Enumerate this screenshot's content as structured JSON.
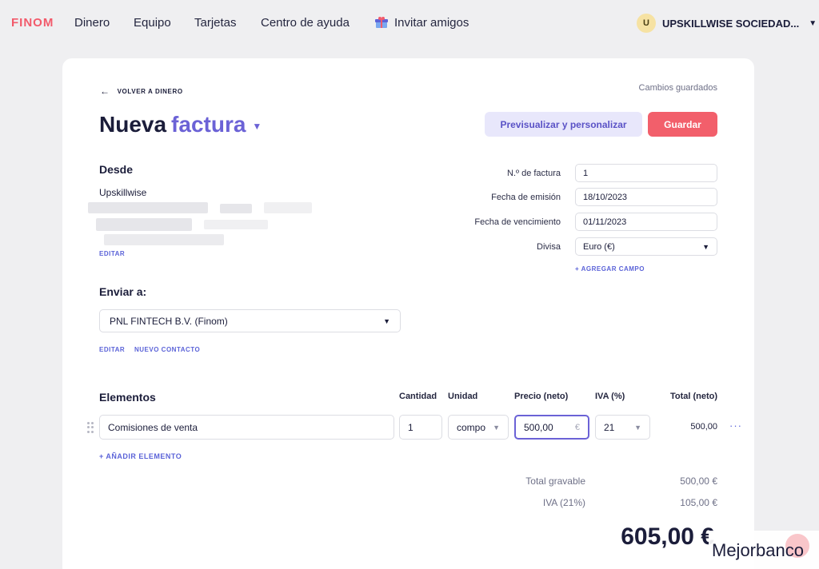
{
  "nav": {
    "logo": "FINOM",
    "links": [
      "Dinero",
      "Equipo",
      "Tarjetas",
      "Centro de ayuda",
      "Invitar amigos"
    ],
    "account_initial": "U",
    "account_name": "UPSKILLWISE SOCIEDAD..."
  },
  "page": {
    "back_label": "VOLVER A DINERO",
    "saved_status": "Cambios guardados",
    "title_part1": "Nueva",
    "title_part2": "factura",
    "preview_button": "Previsualizar y personalizar",
    "save_button": "Guardar"
  },
  "from": {
    "heading": "Desde",
    "company": "Upskillwise",
    "edit_link": "EDITAR"
  },
  "invoice_fields": {
    "number_label": "N.º de factura",
    "number_value": "1",
    "issue_label": "Fecha de emisión",
    "issue_value": "18/10/2023",
    "due_label": "Fecha de vencimiento",
    "due_value": "01/11/2023",
    "currency_label": "Divisa",
    "currency_value": "Euro (€)",
    "add_field": "+ AGREGAR CAMPO"
  },
  "to": {
    "heading": "Enviar a:",
    "contact": "PNL FINTECH B.V. (Finom)",
    "edit_link": "EDITAR",
    "new_contact_link": "NUEVO CONTACTO"
  },
  "items": {
    "heading": "Elementos",
    "col_quantity": "Cantidad",
    "col_unit": "Unidad",
    "col_price": "Precio (neto)",
    "col_vat": "IVA (%)",
    "col_total": "Total (neto)",
    "rows": [
      {
        "description": "Comisiones de venta",
        "quantity": "1",
        "unit": "compo",
        "price": "500,00",
        "currency_suffix": "€",
        "vat": "21",
        "total": "500,00"
      }
    ],
    "add_item": "+ AÑADIR ELEMENTO"
  },
  "summary": {
    "taxable_label": "Total gravable",
    "taxable_value": "500,00 €",
    "vat_label": "IVA (21%)",
    "vat_value": "105,00 €",
    "grand_total": "605,00 €"
  },
  "watermark": {
    "text": "Mejorbanco"
  },
  "colors": {
    "accent": "#6b62d6",
    "brand": "#f25a6b",
    "save_button": "#f25f6b",
    "background": "#efeff1"
  }
}
